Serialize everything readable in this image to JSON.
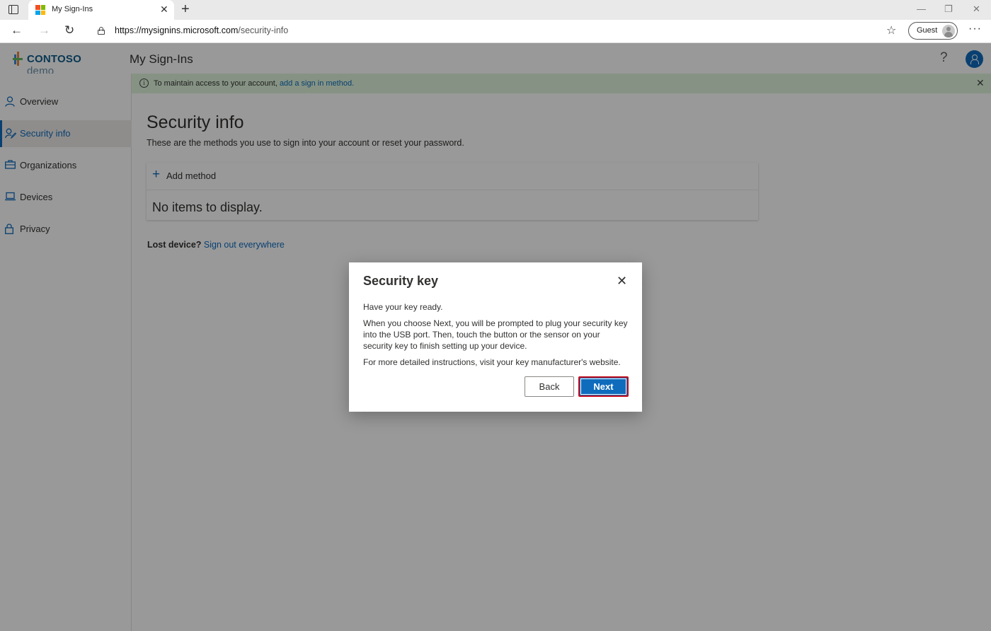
{
  "browser": {
    "tab_title": "My Sign-Ins",
    "tab_close": "✕",
    "new_tab": "+",
    "url_host": "https://mysignins.microsoft.com",
    "url_path": "/security-info",
    "profile_label": "Guest",
    "more": "···"
  },
  "app": {
    "logo_brand": "CONTOSO",
    "logo_suffix": " demo",
    "title": "My Sign-Ins",
    "help": "?"
  },
  "sidebar": {
    "items": [
      {
        "label": "Overview",
        "icon": "person-icon",
        "active": false
      },
      {
        "label": "Security info",
        "icon": "security-info-icon",
        "active": true
      },
      {
        "label": "Organizations",
        "icon": "briefcase-icon",
        "active": false
      },
      {
        "label": "Devices",
        "icon": "laptop-icon",
        "active": false
      },
      {
        "label": "Privacy",
        "icon": "lock-icon",
        "active": false
      }
    ]
  },
  "banner": {
    "text": "To maintain access to your account, ",
    "link": "add a sign in method.",
    "close": "✕"
  },
  "main": {
    "title": "Security info",
    "description": "These are the methods you use to sign into your account or reset your password.",
    "add_method": "Add method",
    "empty": "No items to display.",
    "lost_label": "Lost device?",
    "lost_link": "Sign out everywhere"
  },
  "dialog": {
    "title": "Security key",
    "close": "✕",
    "p1": "Have your key ready.",
    "p2": "When you choose Next, you will be prompted to plug your security key into the USB port. Then, touch the button or the sensor on your security key to finish setting up your device.",
    "p3": "For more detailed instructions, visit your key manufacturer's website.",
    "back": "Back",
    "next": "Next"
  },
  "colors": {
    "accent": "#0f6cbd",
    "banner_bg": "#dff6dd",
    "highlight_border": "#c50f1f"
  }
}
